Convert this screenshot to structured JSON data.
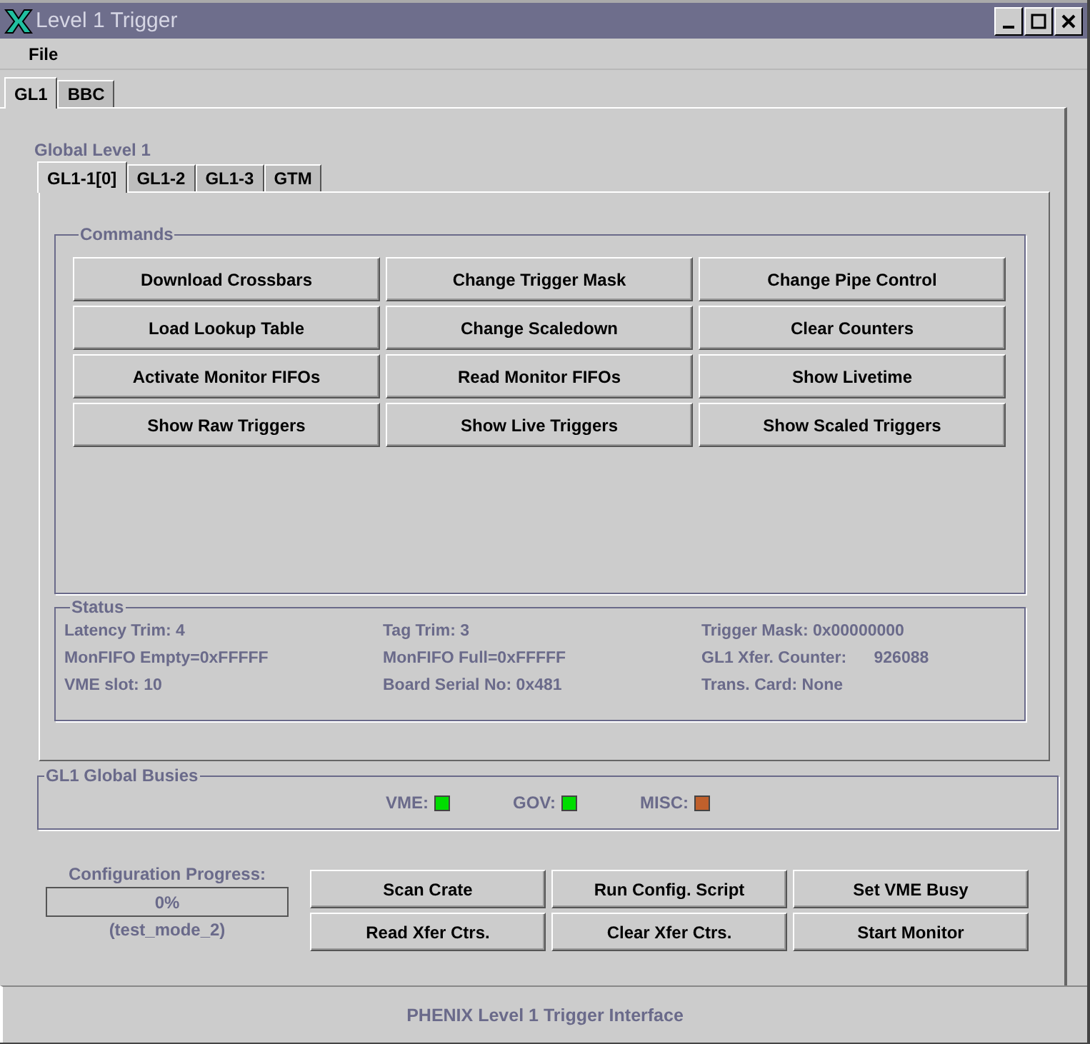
{
  "window": {
    "title": "Level 1 Trigger"
  },
  "menu": [
    "File"
  ],
  "tabs": [
    {
      "label": "GL1",
      "selected": true
    },
    {
      "label": "BBC",
      "selected": false
    }
  ],
  "section_title": "Global Level 1",
  "subtabs": [
    {
      "label": "GL1-1[0]",
      "selected": true
    },
    {
      "label": "GL1-2",
      "selected": false
    },
    {
      "label": "GL1-3",
      "selected": false
    },
    {
      "label": "GTM",
      "selected": false
    }
  ],
  "commands": {
    "title": "Commands",
    "buttons": [
      "Download Crossbars",
      "Change Trigger Mask",
      "Change Pipe Control",
      "Load Lookup Table",
      "Change Scaledown",
      "Clear Counters",
      "Activate Monitor FIFOs",
      "Read Monitor FIFOs",
      "Show Livetime",
      "Show Raw Triggers",
      "Show Live Triggers",
      "Show Scaled Triggers"
    ]
  },
  "status": {
    "title": "Status",
    "fields": [
      "Latency Trim: 4",
      "Tag Trim: 3",
      "Trigger Mask: 0x00000000",
      "MonFIFO Empty=0xFFFFF",
      "MonFIFO Full=0xFFFFF",
      "GL1 Xfer. Counter:      926088",
      "VME slot: 10",
      "Board Serial No: 0x481",
      "Trans. Card: None"
    ]
  },
  "busies": {
    "title": "GL1 Global Busies",
    "items": [
      {
        "label": "VME:",
        "color": "#00dd00"
      },
      {
        "label": "GOV:",
        "color": "#00dd00"
      },
      {
        "label": "MISC:",
        "color": "#c0602c"
      }
    ]
  },
  "progress": {
    "label": "Configuration Progress:",
    "level": 0,
    "reading": "0%",
    "mode": "(test_mode_2)"
  },
  "actions": [
    "Scan Crate",
    "Run Config. Script",
    "Set VME Busy",
    "Read Xfer Ctrs.",
    "Clear Xfer Ctrs.",
    "Start Monitor"
  ],
  "status_bar": "PHENIX Level 1 Trigger Interface"
}
